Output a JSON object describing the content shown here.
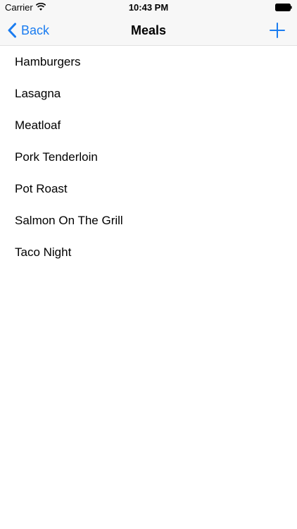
{
  "status_bar": {
    "carrier": "Carrier",
    "time": "10:43 PM"
  },
  "nav": {
    "back_label": "Back",
    "title": "Meals",
    "accent_color": "#1a7cf0"
  },
  "meals": [
    "Hamburgers",
    "Lasagna",
    "Meatloaf",
    "Pork Tenderloin",
    "Pot Roast",
    "Salmon On The Grill",
    "Taco Night"
  ]
}
